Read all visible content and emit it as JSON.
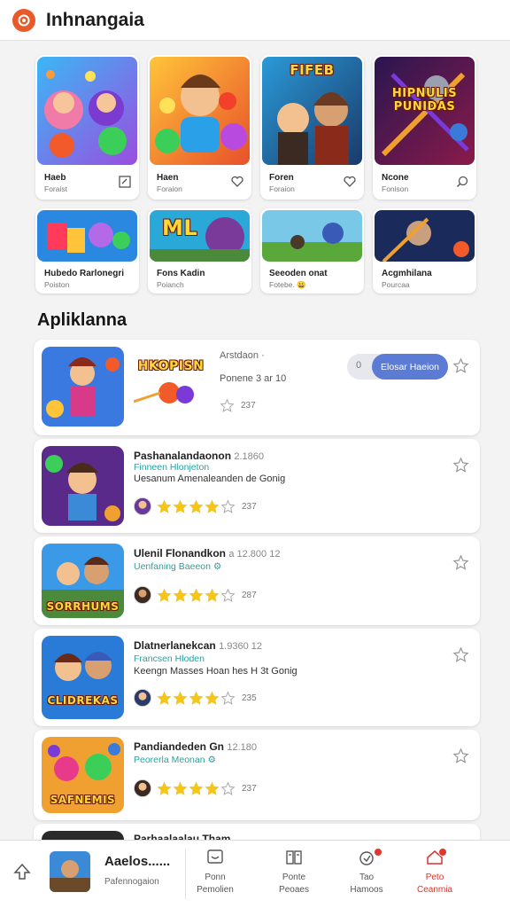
{
  "header": {
    "title": "Inhnangaia",
    "logo_icon": "app-logo-icon"
  },
  "featured": [
    {
      "name": "Haeb",
      "sub": "Foraist",
      "icon": "edit-square-icon"
    },
    {
      "name": "Haen",
      "sub": "Foraion",
      "icon": "heart-icon"
    },
    {
      "name": "Foren",
      "sub": "Foraion",
      "icon": "heart-icon"
    },
    {
      "name": "Ncone",
      "sub": "Fonison",
      "icon": "search-icon"
    }
  ],
  "featured_art_text": [
    "",
    "",
    "FIFEB",
    "HIPNULIS PUNIDAS"
  ],
  "featured_small": [
    {
      "name": "Hubedo Rarlonegri",
      "sub": "Poiston",
      "art_text": ""
    },
    {
      "name": "Fons Kadin",
      "sub": "Poianch",
      "art_text": "ML"
    },
    {
      "name": "Seeoden onat",
      "sub": "Fotebe. 😀",
      "art_text": ""
    },
    {
      "name": "Acgmhilana",
      "sub": "Pourcaa",
      "art_text": ""
    }
  ],
  "section": {
    "title": "Apliklanna"
  },
  "apps": [
    {
      "title": "Arstdaon",
      "meta": "·",
      "sub1": "",
      "sub2": "Ponene 3 ar 10",
      "rating": "237",
      "stars": 0,
      "install": {
        "secondary": "0",
        "label": "Elosar Haeion"
      },
      "promo_text": "HKOPISN"
    },
    {
      "title": "Pashanalandaonon",
      "meta": "2.1860",
      "sub1": "Finneen Hlonjeton",
      "sub2": "Uesanum Amenaleanden de Gonig",
      "rating": "237",
      "stars": 4,
      "thumb_text": ""
    },
    {
      "title": "Ulenil Flonandkon",
      "meta": "a 12.800  12",
      "sub1": "Uenfaning Baeeon ⚙",
      "sub2": "",
      "rating": "287",
      "stars": 4,
      "thumb_text": "SORRHUMS"
    },
    {
      "title": "Dlatnerlanekcan",
      "meta": "1.9360  12",
      "sub1": "Francsen Hloden",
      "sub2": "Keengn Masses Hoan hes H 3t Gonig",
      "rating": "235",
      "stars": 4,
      "thumb_text": "CLIDREKAS"
    },
    {
      "title": "Pandiandeden Gn",
      "meta": "12.180",
      "sub1": "Peorerla Meonan ⚙",
      "sub2": "",
      "rating": "237",
      "stars": 4,
      "thumb_text": "SAFNEMIS"
    },
    {
      "title": "Parhaalaalau Tham",
      "meta": "",
      "sub1": "",
      "sub2": "",
      "rating": "",
      "stars": 0,
      "thumb_text": ""
    }
  ],
  "bottom_nav": {
    "now_playing": {
      "title": "Aaelos......",
      "sub": "Pafennogaion"
    },
    "items": [
      {
        "line1": "Ponn",
        "line2": "Pemolien",
        "icon": "smiley-icon"
      },
      {
        "line1": "Ponte",
        "line2": "Peoaes",
        "icon": "library-icon"
      },
      {
        "line1": "Tao",
        "line2": "Hamoos",
        "icon": "alert-icon"
      },
      {
        "line1": "Peto",
        "line2": "Ceanmia",
        "icon": "home-icon"
      }
    ]
  },
  "colors": {
    "accent": "#5b7bd5",
    "star": "#f5c518",
    "logo": "#e85a2a",
    "active_nav": "#d9322a"
  }
}
